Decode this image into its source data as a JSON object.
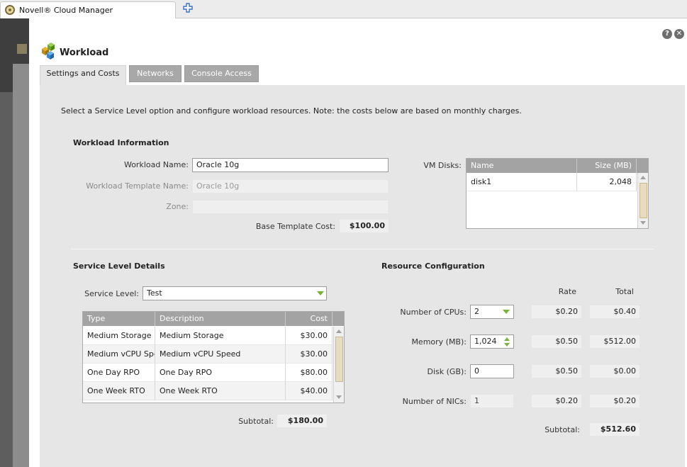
{
  "browser": {
    "tab_title": "Novell® Cloud Manager"
  },
  "dialog": {
    "title": "Workload",
    "help_label": "?",
    "close_label": "✕",
    "tabs": [
      {
        "label": "Settings and Costs",
        "active": true
      },
      {
        "label": "Networks",
        "active": false
      },
      {
        "label": "Console Access",
        "active": false
      }
    ],
    "intro": "Select a Service Level option and configure workload resources. Note: the costs below are based on monthly charges."
  },
  "workload_info": {
    "section_title": "Workload Information",
    "name_label": "Workload Name:",
    "name_value": "Oracle 10g",
    "template_label": "Workload Template Name:",
    "template_value": "Oracle 10g",
    "zone_label": "Zone:",
    "zone_value": "",
    "base_cost_label": "Base Template Cost:",
    "base_cost_value": "$100.00"
  },
  "vm_disks": {
    "label": "VM Disks:",
    "columns": [
      "Name",
      "Size (MB)"
    ],
    "rows": [
      {
        "name": "disk1",
        "size": "2,048"
      }
    ]
  },
  "service_level": {
    "section_title": "Service Level Details",
    "level_label": "Service Level:",
    "level_value": "Test",
    "columns": [
      "Type",
      "Description",
      "Cost"
    ],
    "rows": [
      {
        "type": "Medium Storage",
        "description": "Medium Storage",
        "cost": "$30.00"
      },
      {
        "type": "Medium vCPU Spe",
        "description": "Medium vCPU Speed",
        "cost": "$30.00"
      },
      {
        "type": "One Day RPO",
        "description": "One Day RPO",
        "cost": "$80.00"
      },
      {
        "type": "One Week RTO",
        "description": "One Week RTO",
        "cost": "$40.00"
      }
    ],
    "subtotal_label": "Subtotal:",
    "subtotal_value": "$180.00"
  },
  "resources": {
    "section_title": "Resource Configuration",
    "rate_header": "Rate",
    "total_header": "Total",
    "items": [
      {
        "label": "Number of CPUs:",
        "value": "2",
        "rate": "$0.20",
        "total": "$0.40"
      },
      {
        "label": "Memory (MB):",
        "value": "1,024",
        "rate": "$0.50",
        "total": "$512.00"
      },
      {
        "label": "Disk (GB):",
        "value": "0",
        "rate": "$0.50",
        "total": "$0.00"
      },
      {
        "label": "Number of NICs:",
        "value": "1",
        "rate": "$0.20",
        "total": "$0.20"
      }
    ],
    "subtotal_label": "Subtotal:",
    "subtotal_value": "$512.60"
  }
}
